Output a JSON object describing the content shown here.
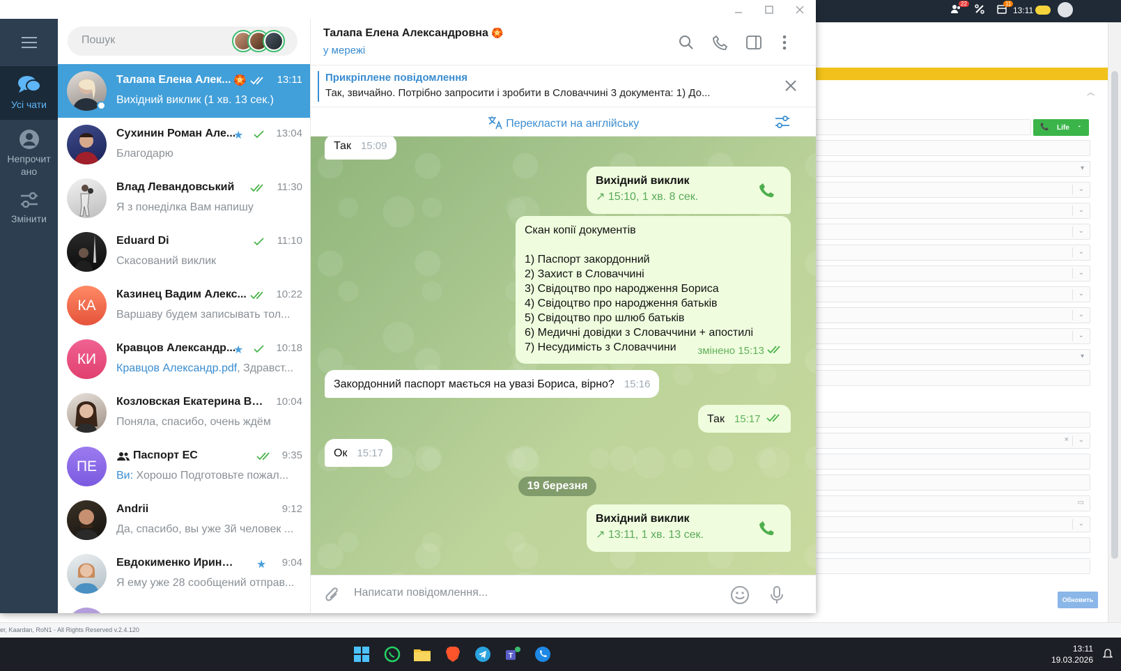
{
  "window": {
    "minimize": "—",
    "maximize": "☐",
    "close": "✕"
  },
  "rail": {
    "items": [
      {
        "label": "Усі чати"
      },
      {
        "label": "Непрочит ано"
      },
      {
        "label": "Змінити"
      }
    ]
  },
  "search": {
    "placeholder": "Пошук"
  },
  "chats": [
    {
      "name": "Талапа Елена Алек...",
      "time": "13:11",
      "preview": "Вихідний виклик (1 хв. 13 сек.)"
    },
    {
      "name": "Сухинин Роман Але...",
      "time": "13:04",
      "preview": "Благодарю"
    },
    {
      "name": "Влад Левандовський",
      "time": "11:30",
      "preview": "Я з понеділка Вам напишу"
    },
    {
      "name": "Eduard Di",
      "time": "11:10",
      "preview": "Скасований виклик"
    },
    {
      "name": "Казинец Вадим Алекс...",
      "time": "10:22",
      "preview": "Варшаву будем записывать тол...",
      "initials": "КА"
    },
    {
      "name": "Кравцов Александр...",
      "time": "10:18",
      "preview_hl": "Кравцов Александр.pdf",
      "preview": ", Здравст...",
      "initials": "КИ"
    },
    {
      "name": "Козловская Екатерина Вл...",
      "time": "10:04",
      "preview": "Поняла, спасибо, очень ждём"
    },
    {
      "name": "Паспорт ЕС",
      "time": "9:35",
      "preview_hl": "Ви:",
      "preview": " Хорошо Подготовьте пожал...",
      "initials": "ПЕ"
    },
    {
      "name": "Andrii",
      "time": "9:12",
      "preview": "Да, спасибо, вы уже 3й человек ..."
    },
    {
      "name": "Евдокименко Ирина Ви...",
      "time": "9:04",
      "preview": "Я ему уже 28 сообщений отправ..."
    }
  ],
  "header": {
    "name": "Талапа Елена Александровна",
    "status": "у мережі"
  },
  "pinned": {
    "title": "Прикріплене повідомлення",
    "text": "Так, звичайно. Потрібно запросити і зробити в Словаччині 3 документа: 1) До..."
  },
  "translate": {
    "label": "Перекласти на англійську"
  },
  "messages": {
    "m1": {
      "text": "Так",
      "time": "15:09"
    },
    "call1": {
      "title": "Вихідний виклик",
      "details": "15:10, 1 хв. 8 сек."
    },
    "list": {
      "lines": [
        "Скан копії документів",
        "",
        "1) Паспорт закордонний",
        "2) Захист в Словаччині",
        "3) Свідоцтво про народження Бориса",
        "4) Свідоцтво про народження батьків",
        "5) Свідоцтво про шлюб батьків",
        "6) Медичні довідки з Словаччини + апостилі",
        "7) Несудимість з Словаччини"
      ],
      "time": "змінено 15:13"
    },
    "q": {
      "text": "Закордонний паспорт мається на увазі Бориса, вірно?",
      "time": "15:16"
    },
    "m2": {
      "text": "Так",
      "time": "15:17"
    },
    "m3": {
      "text": "Ок",
      "time": "15:17"
    },
    "date": "19 березня",
    "call2": {
      "title": "Вихідний виклик",
      "details": "13:11, 1 хв. 13 сек."
    }
  },
  "composer": {
    "placeholder": "Написати повідомлення..."
  },
  "background": {
    "tray_time": "13:11",
    "badge1": "22",
    "badge2": "11",
    "call_btn": "Life",
    "update_btn": "Обновить",
    "footer": "er, Kaardan, RoN1 - All Rights Reserved v.2.4.120"
  },
  "taskbar": {
    "time": "13:11",
    "date": "19.03.2026"
  },
  "colors": {
    "accent": "#419fd9",
    "rail": "#2c3e50",
    "out_bubble": "#effdde"
  }
}
